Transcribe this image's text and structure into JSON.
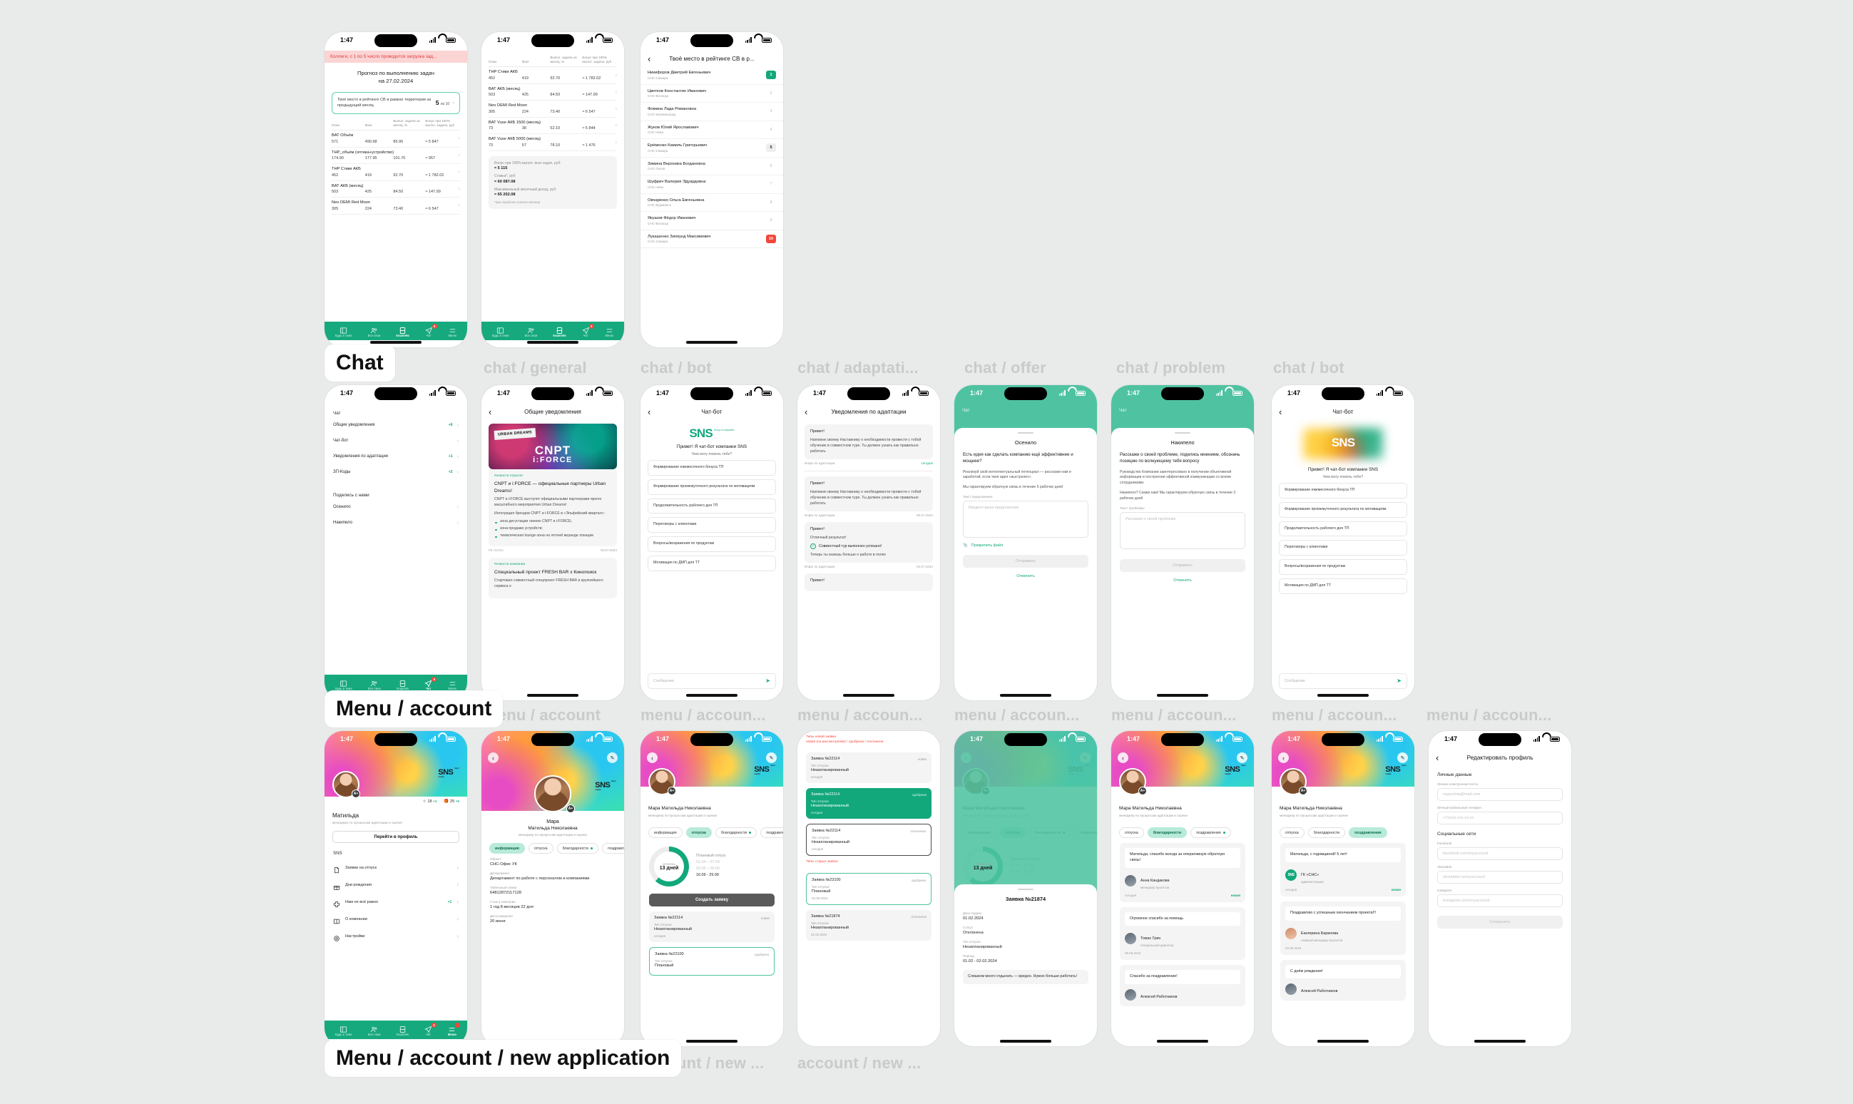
{
  "meta": {
    "status_time": "1:47"
  },
  "groups": [
    {
      "label": "Chat"
    },
    {
      "label": "Menu / account"
    },
    {
      "label": "Menu / account / new application"
    }
  ],
  "frame_labels": [
    "chat / general",
    "chat / bot",
    "chat / adaptati...",
    "chat / offer",
    "chat / problem",
    "chat / bot",
    "menu / account",
    "menu / accoun...",
    "menu / accoun...",
    "menu / accoun...",
    "menu / accoun...",
    "menu / accoun...",
    "menu / accoun...",
    "account / new ...",
    "account / new ..."
  ],
  "tabbar": {
    "items": [
      {
        "label": "Будь в теме",
        "icon": "book-icon",
        "badge": ""
      },
      {
        "label": "Все свои",
        "icon": "people-icon",
        "badge": ""
      },
      {
        "label": "Кошелёк",
        "icon": "wallet-icon",
        "badge": ""
      },
      {
        "label": "Чат",
        "icon": "send-icon",
        "badge": "9"
      },
      {
        "label": "Меню",
        "icon": "menu-icon",
        "badge": ""
      }
    ]
  },
  "wallet": {
    "alert": "Коллеги, с 1 по 5 число проводится загрузка зад...",
    "title_line1": "Прогноз по выполнению задач",
    "title_line2": "на 27.02.2024",
    "rank_card": {
      "text": "Твоё место в рейтинге СВ в рамках территории за предыдущий месяц",
      "value": "5",
      "of": "из 10"
    },
    "columns": [
      "План",
      "Факт",
      "Выпол. задачи за месяц, %",
      "Бонус при 100% выпол. задачи, руб"
    ],
    "rows": [
      {
        "name": "BAT Объём",
        "plan": "571",
        "fact": "490.68",
        "pct": "85.90",
        "bonus": "≈ 5 847"
      },
      {
        "name": "THP_объём (оптика+устройство)",
        "plan": "174.90",
        "fact": "177.95",
        "pct": "101.70",
        "bonus": "≈ 957"
      },
      {
        "name": "THP Стики АКБ",
        "plan": "452",
        "fact": "419",
        "pct": "92.70",
        "bonus": "≈ 1 782.02"
      },
      {
        "name": "BAT АКБ (месяц)",
        "plan": "503",
        "fact": "425",
        "pct": "84.50",
        "bonus": "≈ 147.99"
      },
      {
        "name": "Neo DEMI Red Moon",
        "plan": "305",
        "fact": "224",
        "pct": "73.40",
        "bonus": "≈ 6 547"
      },
      {
        "name": "BAT Vuse АКБ 1500 (месяц)",
        "plan": "73",
        "fact": "38",
        "pct": "52.10",
        "bonus": "≈ 5 844"
      },
      {
        "name": "BAT Vuse АКБ 5000 (месяц)",
        "plan": "73",
        "fact": "57",
        "pct": "78.10",
        "bonus": "≈ 1 476"
      }
    ],
    "summary": {
      "bonus_label": "Бонус при 100% выпол. всех задач, руб:",
      "bonus_value": "≈ 5 115",
      "rate_label": "Ставка*, руб:",
      "rate_value": "≈ 60 087.08",
      "max_label": "Максимальный месячный доход, руб:",
      "max_value": "≈ 65 202.08",
      "note": "*при отработке полного месяца"
    }
  },
  "rating": {
    "title": "Твоё место в рейтинге СВ в р...",
    "rows": [
      {
        "name": "Никифоров Дмитрий Евгеньевич",
        "org": "СНС-Самара",
        "pos": "1",
        "style": "first"
      },
      {
        "name": "Цветков Константин Иванович",
        "org": "СНС-Вологда",
        "pos": "2",
        "style": ""
      },
      {
        "name": "Фомина Лада Романовна",
        "org": "СНС-Калининград",
        "pos": "3",
        "style": ""
      },
      {
        "name": "Жуков Юлий Ярославович",
        "org": "СНС Нева",
        "pos": "4",
        "style": ""
      },
      {
        "name": "Ерёменко Камиль Григорьевич",
        "org": "СНС-Самара",
        "pos": "5",
        "style": "me"
      },
      {
        "name": "Зимина Вероника Богдановна",
        "org": "СНС-Псков",
        "pos": "6",
        "style": ""
      },
      {
        "name": "Шуфрич Валерия Эдуардовна",
        "org": "СНС Нева",
        "pos": "7",
        "style": ""
      },
      {
        "name": "Овчаренко Ольга Евгеньевна",
        "org": "СНС-Мурманск",
        "pos": "8",
        "style": ""
      },
      {
        "name": "Якушев Фёдор Иванович",
        "org": "СНС-Вологда",
        "pos": "9",
        "style": ""
      },
      {
        "name": "Лукашенко Зигмунд Максимович",
        "org": "СНС-Самара",
        "pos": "10",
        "style": "last"
      }
    ]
  },
  "chat_menu": {
    "title": "Чат",
    "items": [
      {
        "label": "Общие уведомления",
        "count": "+6"
      },
      {
        "label": "Чат-бот",
        "count": ""
      },
      {
        "label": "Уведомления по адаптации",
        "count": "+1"
      },
      {
        "label": "ЗП-Коды",
        "count": "+2"
      }
    ],
    "section2": "Поделись с нами",
    "items2": [
      {
        "label": "Осенило",
        "count": ""
      },
      {
        "label": "Накипело",
        "count": ""
      }
    ]
  },
  "news": {
    "title": "Общие уведомления",
    "banner_brand": "URBAN DREAMS",
    "banner_main": "CNPT",
    "banner_sub": "i:FORCE",
    "card1": {
      "tag": "#новости отрасли",
      "headline": "CNPT и i:FORCE — официальные партнеры Urban Dreams!",
      "p1": "CNPT и i:FORCE выступят официальными партнерами яркого масштабного мероприятия Urban Dreams!",
      "p2": "Интеграция брендов CNPT и i:FORCE в «Эльфийский квартал»:",
      "bullets": [
        "зона дегустации линеек CNPT и i:FORCE;",
        "зона продажи устройств;",
        "тематическая lounge-зона на летней веранде локации"
      ],
      "source": "ГК «СНС»",
      "date": "03.07.2024"
    },
    "card2": {
      "tag": "#новости компании",
      "headline": "Специальный проект FRESH BAR x Кинопоиск",
      "p1": "Стартовал совместный спецпроект FRESH BAR и крупнейшего сервиса о"
    }
  },
  "bot": {
    "title": "Чат-бот",
    "logo": "SNS",
    "logo_sub": "Group of companies",
    "hello": "Привет! Я чат-бот компании SNS",
    "sub": "Чем могу помочь тебе?",
    "options": [
      "Формирование ежемесячного бонуса ТП",
      "Формирование промежуточного результата по мотивациям",
      "Продолжительность рабочего дня ТП",
      "Переговоры с клиентами",
      "Вопросы/возражения по продуктам",
      "Мотивация по ДМП для ТТ"
    ],
    "input_placeholder": "Сообщение"
  },
  "adaptation": {
    "title": "Уведомления по адаптации",
    "items": [
      {
        "hi": "Привет!",
        "text": "Напомни своему Наставнику о необходимости провести с тобой обучение в совместном туре. Ты должен узнать как правильно работать",
        "source": "Инфо по адаптации",
        "date": "сегодня",
        "today": true
      },
      {
        "hi": "Привет!",
        "text": "Напомни своему Наставнику о необходимости провести с тобой обучение в совместном туре. Ты должен узнать как правильно работать",
        "source": "Инфо по адаптации",
        "date": "05.07.2024",
        "today": false
      },
      {
        "hi": "Привет!",
        "text": "Отличный результат!",
        "ok": "Совместный тур выполнен успешно!",
        "text2": "Теперь ты знаешь больше о работе в полях",
        "source": "Инфо по адаптации",
        "date": "04.07.2024",
        "today": false
      },
      {
        "hi": "Привет!"
      }
    ]
  },
  "offer": {
    "top_title": "Чат",
    "header": "Осенило",
    "lead": "Есть идея как сделать компанию ещё эффективнее и мощнее?",
    "p1": "Реализуй свой интеллектуальный потенциал — расскажи нам и заработай, если твоя идея «выстрелит».",
    "p2": "Мы гарантируем обратную связь в течение 5 рабочих дней",
    "field_label": "Текст предложения",
    "field_placeholder": "Введите ваше предложение",
    "attach": "Прикрепить файл",
    "send": "Отправить",
    "cancel": "Отменить"
  },
  "problem": {
    "top_title": "Чат",
    "header": "Накипело",
    "lead": "Расскажи о своей проблеме, поделись мнением, обозначь позицию по волнующему тебя вопросу",
    "p1": "Руководство Компании заинтересовано в получении объективной информации и построении эффективной коммуникации со всеми сотрудниками.",
    "p2": "Накипело? Скажи нам! Мы гарантируем обратную связь в течение 3 рабочих дней",
    "field_label": "Текст проблемы",
    "field_placeholder": "Расскажи о своей проблеме",
    "send": "Отправить",
    "cancel": "Отменить"
  },
  "account": {
    "name": "Матильда",
    "role": "менеджер по процессам адаптации и оценке",
    "badge": "A+",
    "stars": "18",
    "stars_plus": "+1",
    "gifts": "25",
    "gifts_plus": "+2",
    "profile_button": "Перейти в профиль",
    "section": "SNS",
    "items": [
      {
        "label": "Заявки на отпуск",
        "icon": "document-icon",
        "count": ""
      },
      {
        "label": "Дни рождения",
        "icon": "gift-icon",
        "count": ""
      },
      {
        "label": "Нам не всё равно",
        "icon": "cross-icon",
        "count": "+1"
      },
      {
        "label": "О компании",
        "icon": "book-icon",
        "count": ""
      },
      {
        "label": "Настройки",
        "icon": "gear-icon",
        "count": ""
      }
    ]
  },
  "profile": {
    "name_first": "Мара",
    "name_rest": "Матильда Николаевна",
    "name_full": "Мара Матильда Николаевна",
    "role": "менеджер по процессам адаптации и оценке",
    "tabs": [
      "информация",
      "отпуска",
      "благодарности",
      "поздравления"
    ],
    "info": [
      {
        "label": "Объект",
        "value": "СНС-Офис УК"
      },
      {
        "label": "Департамент",
        "value": "Департамент по работе с персоналом и компаниями"
      },
      {
        "label": "Табельный номер",
        "value": "64812872117128"
      },
      {
        "label": "Стаж в компании",
        "value": "1 год 8 месяцев 22 дня"
      },
      {
        "label": "Дата рождения",
        "value": "20 июня"
      }
    ]
  },
  "vacation": {
    "ring_label": "осталось",
    "ring_value": "13 дней",
    "list_title": "Плановый отпуск",
    "dates": [
      "01.04 – 07.04",
      "03.06 – 09.06",
      "16.09 - 29.09"
    ],
    "create_button": "Создать заявку",
    "requests": [
      {
        "num": "Заявка №22114",
        "status": "новая",
        "type_label": "Тип отпуска",
        "type": "Незапланированный",
        "date": "сегодня",
        "style": "grey"
      },
      {
        "num": "Заявка №22100",
        "status": "одобрена",
        "type_label": "Тип отпуска",
        "type": "Плановый",
        "date": "02.06.2024",
        "style": "greenline"
      }
    ]
  },
  "request_types": {
    "anno1": "Типы новой заявки\nновая (на рассмотрении) / одобрена / отклонена",
    "anno2": "Типы старых заявок",
    "new": [
      {
        "num": "Заявка №22114",
        "status": "новая",
        "type_label": "Тип отпуска",
        "type": "Незапланированный",
        "date": "сегодня",
        "style": "grey"
      },
      {
        "num": "Заявка №22114",
        "status": "одобрена",
        "type_label": "Тип отпуска",
        "type": "Незапланированный",
        "date": "сегодня",
        "style": "green"
      },
      {
        "num": "Заявка №22114",
        "status": "отклонена",
        "type_label": "Тип отпуска",
        "type": "Незапланированный",
        "date": "сегодня",
        "style": "outline"
      }
    ],
    "old": [
      {
        "num": "Заявка №22100",
        "status": "одобрена",
        "type_label": "Тип отпуска",
        "type": "Плановый",
        "date": "02.06.2024",
        "style": "greenline"
      },
      {
        "num": "Заявка №21874",
        "status": "отклонена",
        "type_label": "Тип отпуска",
        "type": "Незапланированный",
        "date": "01.02.2024",
        "style": "grey"
      }
    ]
  },
  "request_detail": {
    "header": "Заявка №21874",
    "fields": [
      {
        "label": "Дата подачи",
        "value": "01.02.2024"
      },
      {
        "label": "Статус",
        "value": "Отклонена"
      },
      {
        "label": "Тип отпуска",
        "value": "Незапланированный"
      },
      {
        "label": "Период",
        "value": "01.02 - 02.02.2024"
      }
    ],
    "comment": "Слишком много отдыхать — вредно. Нужно больше работать!"
  },
  "thanks": {
    "tabs": [
      "отпуска",
      "благодарности",
      "поздравления"
    ],
    "active": "благодарности",
    "cards": [
      {
        "text": "Матильда, спасибо всегда за оперативную обратную связь!",
        "name": "Анна Кандакова",
        "role": "менеджер проектов",
        "date": "сегодня",
        "new": "новая"
      },
      {
        "text": "Огромное спасибо за помощь",
        "name": "Томас Грин",
        "role": "генеральный директор",
        "date": "08.05.2024",
        "new": ""
      },
      {
        "text": "Спасибо за поздравление!",
        "name": "Алексей Работников",
        "role": "",
        "date": "",
        "new": ""
      }
    ]
  },
  "congrats": {
    "tabs": [
      "отпуска",
      "благодарности",
      "поздравления"
    ],
    "active": "поздравления",
    "cards": [
      {
        "text": "Матильда, с годовщиной! 5 лет!",
        "name": "ГК «СНС»",
        "role": "администрация",
        "date": "сегодня",
        "new": "новая",
        "avatar": "sns"
      },
      {
        "text": "Поздравляю с успешным окончанием проекта!!!",
        "name": "Екатерина Баринова",
        "role": "главный менеджер проектов",
        "date": "03.05.2024",
        "new": "",
        "avatar": "photo"
      },
      {
        "text": "С днём рождения!",
        "name": "Алексей Работников",
        "role": "",
        "date": "",
        "new": "",
        "avatar": "photo2"
      }
    ]
  },
  "edit_profile": {
    "title": "Редактировать профиль",
    "sec1": "Личные данные",
    "fields1": [
      {
        "label": "Личная электронная почта",
        "placeholder": "mypochta@mail.com"
      },
      {
        "label": "Личный мобильный телефон",
        "placeholder": "+7(xxx) xxx-xx-xx"
      }
    ],
    "sec2": "Социальные сети",
    "fields2": [
      {
        "label": "Facebook",
        "placeholder": "facebook.com/myaccount"
      },
      {
        "label": "Vkontakte",
        "placeholder": "vkontakte.ru/myaccount"
      },
      {
        "label": "Instagram",
        "placeholder": "instagram.com/myaccount"
      }
    ],
    "save": "Сохранить"
  }
}
